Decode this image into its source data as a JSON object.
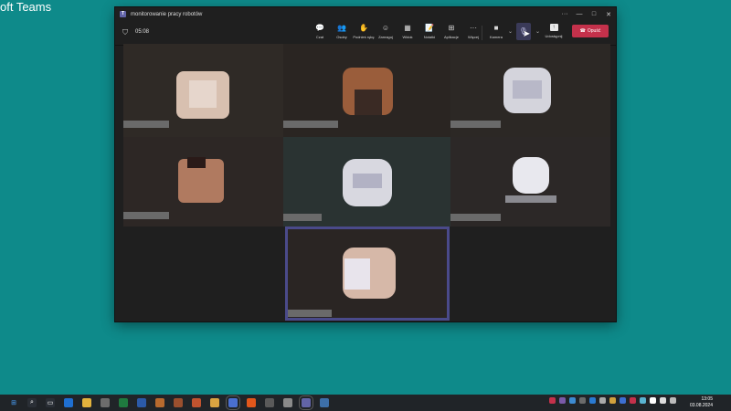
{
  "desktop": {
    "title_fragment": "oft Teams"
  },
  "window": {
    "title": "monitorowanie pracy robotów",
    "controls": [
      "···",
      "—",
      "□",
      "✕"
    ]
  },
  "meeting": {
    "timer": "05:08",
    "tools": [
      {
        "label": "Czat",
        "icon": "chat-icon",
        "glyph": "💬"
      },
      {
        "label": "Osoby",
        "icon": "people-icon",
        "glyph": "👥"
      },
      {
        "label": "Podnieś rękę",
        "icon": "raise-hand-icon",
        "glyph": "✋"
      },
      {
        "label": "Zareaguj",
        "icon": "react-icon",
        "glyph": "☺"
      },
      {
        "label": "Widok",
        "icon": "view-icon",
        "glyph": "▦"
      },
      {
        "label": "Notatki",
        "icon": "notes-icon",
        "glyph": "📝"
      },
      {
        "label": "Aplikacje",
        "icon": "apps-icon",
        "glyph": "⊞"
      },
      {
        "label": "Więcej",
        "icon": "more-icon",
        "glyph": "···"
      }
    ],
    "camera_label": "Kamera",
    "share_label": "Udostępnij",
    "leave_label": "Opuść"
  },
  "colors": {
    "desktop_bg": "#0e8a8a",
    "leave_button": "#c4314b",
    "teams_purple": "#6264a7",
    "active_speaker_border": "#4a4a8a"
  },
  "taskbar": {
    "apps": [
      "start-icon",
      "search-icon",
      "task-view-icon",
      "edge-icon",
      "file-explorer-icon",
      "calculator-icon",
      "excel-icon",
      "word-icon",
      "app-icon",
      "app-icon",
      "app-icon",
      "app-icon",
      "teams-icon",
      "firefox-icon",
      "app-icon",
      "app-icon",
      "teams-icon",
      "app-icon"
    ],
    "time": "13:05",
    "date": "03.08.2024"
  }
}
